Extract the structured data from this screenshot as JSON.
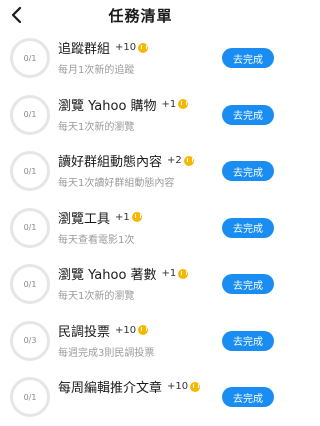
{
  "header": {
    "title": "任務清單"
  },
  "tasks": [
    {
      "progress": "0/1",
      "name": "追蹤群組",
      "points": "+10",
      "desc": "每月1次新的追蹤",
      "button": "去完成"
    },
    {
      "progress": "0/1",
      "name": "瀏覽 Yahoo 購物",
      "points": "+1",
      "desc": "每天1次新的瀏覽",
      "button": "去完成"
    },
    {
      "progress": "0/1",
      "name": "讀好群組動態內容",
      "points": "+2",
      "desc": "每天1次讀好群組動態內容",
      "button": "去完成"
    },
    {
      "progress": "0/1",
      "name": "瀏覽工具",
      "points": "+1",
      "desc": "每天查看電影1次",
      "button": "去完成"
    },
    {
      "progress": "0/1",
      "name": "瀏覽 Yahoo 著數",
      "points": "+1",
      "desc": "每天1次新的瀏覽",
      "button": "去完成"
    },
    {
      "progress": "0/3",
      "name": "民調投票",
      "points": "+10",
      "desc": "每週完成3則民調投票",
      "button": "去完成"
    },
    {
      "progress": "0/1",
      "name": "每周編輯推介文章",
      "points": "+10",
      "desc": "",
      "button": "去完成"
    }
  ]
}
